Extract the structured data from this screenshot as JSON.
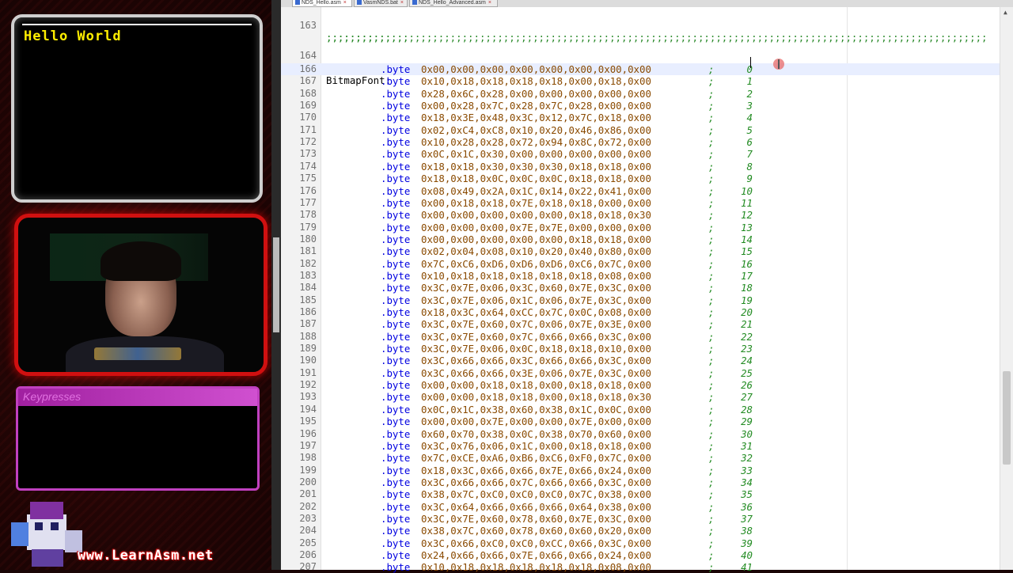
{
  "overlay": {
    "screen_text": "Hello World",
    "keypresses_title": "Keypresses",
    "site": "www.LearnAsm.net"
  },
  "tabs": [
    {
      "label": "NDS_Hello.asm",
      "active": true
    },
    {
      "label": "VasmNDS.bat",
      "active": false
    },
    {
      "label": "NDS_Hello_Advanced.asm",
      "active": false
    }
  ],
  "editor": {
    "separator": ";;;;;;;;;;;;;;;;;;;;;;;;;;;;;;;;;;;;;;;;;;;;;;;;;;;;;;;;;;;;;;;;;;;;;;;;;;;;;;;;;;;;;;;;;;;;;;;;;;;;;;;;;;;;;;;;",
    "separator_wrap": ";;;;;;;;;;;;;;",
    "label": "BitmapFont:",
    "keyword": ".byte",
    "comment_char": ";",
    "lines": [
      {
        "n": "166",
        "hex": "0x00,0x00,0x00,0x00,0x00,0x00,0x00,0x00",
        "c": "0"
      },
      {
        "n": "167",
        "hex": "0x10,0x18,0x18,0x18,0x18,0x00,0x18,0x00",
        "c": "1"
      },
      {
        "n": "168",
        "hex": "0x28,0x6C,0x28,0x00,0x00,0x00,0x00,0x00",
        "c": "2"
      },
      {
        "n": "169",
        "hex": "0x00,0x28,0x7C,0x28,0x7C,0x28,0x00,0x00",
        "c": "3"
      },
      {
        "n": "170",
        "hex": "0x18,0x3E,0x48,0x3C,0x12,0x7C,0x18,0x00",
        "c": "4"
      },
      {
        "n": "171",
        "hex": "0x02,0xC4,0xC8,0x10,0x20,0x46,0x86,0x00",
        "c": "5"
      },
      {
        "n": "172",
        "hex": "0x10,0x28,0x28,0x72,0x94,0x8C,0x72,0x00",
        "c": "6"
      },
      {
        "n": "173",
        "hex": "0x0C,0x1C,0x30,0x00,0x00,0x00,0x00,0x00",
        "c": "7"
      },
      {
        "n": "174",
        "hex": "0x18,0x18,0x30,0x30,0x30,0x18,0x18,0x00",
        "c": "8"
      },
      {
        "n": "175",
        "hex": "0x18,0x18,0x0C,0x0C,0x0C,0x18,0x18,0x00",
        "c": "9"
      },
      {
        "n": "176",
        "hex": "0x08,0x49,0x2A,0x1C,0x14,0x22,0x41,0x00",
        "c": "10"
      },
      {
        "n": "177",
        "hex": "0x00,0x18,0x18,0x7E,0x18,0x18,0x00,0x00",
        "c": "11"
      },
      {
        "n": "178",
        "hex": "0x00,0x00,0x00,0x00,0x00,0x18,0x18,0x30",
        "c": "12"
      },
      {
        "n": "179",
        "hex": "0x00,0x00,0x00,0x7E,0x7E,0x00,0x00,0x00",
        "c": "13"
      },
      {
        "n": "180",
        "hex": "0x00,0x00,0x00,0x00,0x00,0x18,0x18,0x00",
        "c": "14"
      },
      {
        "n": "181",
        "hex": "0x02,0x04,0x08,0x10,0x20,0x40,0x80,0x00",
        "c": "15"
      },
      {
        "n": "182",
        "hex": "0x7C,0xC6,0xD6,0xD6,0xD6,0xC6,0x7C,0x00",
        "c": "16"
      },
      {
        "n": "183",
        "hex": "0x10,0x18,0x18,0x18,0x18,0x18,0x08,0x00",
        "c": "17"
      },
      {
        "n": "184",
        "hex": "0x3C,0x7E,0x06,0x3C,0x60,0x7E,0x3C,0x00",
        "c": "18"
      },
      {
        "n": "185",
        "hex": "0x3C,0x7E,0x06,0x1C,0x06,0x7E,0x3C,0x00",
        "c": "19"
      },
      {
        "n": "186",
        "hex": "0x18,0x3C,0x64,0xCC,0x7C,0x0C,0x08,0x00",
        "c": "20"
      },
      {
        "n": "187",
        "hex": "0x3C,0x7E,0x60,0x7C,0x06,0x7E,0x3E,0x00",
        "c": "21"
      },
      {
        "n": "188",
        "hex": "0x3C,0x7E,0x60,0x7C,0x66,0x66,0x3C,0x00",
        "c": "22"
      },
      {
        "n": "189",
        "hex": "0x3C,0x7E,0x06,0x0C,0x18,0x18,0x10,0x00",
        "c": "23"
      },
      {
        "n": "190",
        "hex": "0x3C,0x66,0x66,0x3C,0x66,0x66,0x3C,0x00",
        "c": "24"
      },
      {
        "n": "191",
        "hex": "0x3C,0x66,0x66,0x3E,0x06,0x7E,0x3C,0x00",
        "c": "25"
      },
      {
        "n": "192",
        "hex": "0x00,0x00,0x18,0x18,0x00,0x18,0x18,0x00",
        "c": "26"
      },
      {
        "n": "193",
        "hex": "0x00,0x00,0x18,0x18,0x00,0x18,0x18,0x30",
        "c": "27"
      },
      {
        "n": "194",
        "hex": "0x0C,0x1C,0x38,0x60,0x38,0x1C,0x0C,0x00",
        "c": "28"
      },
      {
        "n": "195",
        "hex": "0x00,0x00,0x7E,0x00,0x00,0x7E,0x00,0x00",
        "c": "29"
      },
      {
        "n": "196",
        "hex": "0x60,0x70,0x38,0x0C,0x38,0x70,0x60,0x00",
        "c": "30"
      },
      {
        "n": "197",
        "hex": "0x3C,0x76,0x06,0x1C,0x00,0x18,0x18,0x00",
        "c": "31"
      },
      {
        "n": "198",
        "hex": "0x7C,0xCE,0xA6,0xB6,0xC6,0xF0,0x7C,0x00",
        "c": "32"
      },
      {
        "n": "199",
        "hex": "0x18,0x3C,0x66,0x66,0x7E,0x66,0x24,0x00",
        "c": "33"
      },
      {
        "n": "200",
        "hex": "0x3C,0x66,0x66,0x7C,0x66,0x66,0x3C,0x00",
        "c": "34"
      },
      {
        "n": "201",
        "hex": "0x38,0x7C,0xC0,0xC0,0xC0,0x7C,0x38,0x00",
        "c": "35"
      },
      {
        "n": "202",
        "hex": "0x3C,0x64,0x66,0x66,0x66,0x64,0x38,0x00",
        "c": "36"
      },
      {
        "n": "203",
        "hex": "0x3C,0x7E,0x60,0x78,0x60,0x7E,0x3C,0x00",
        "c": "37"
      },
      {
        "n": "204",
        "hex": "0x38,0x7C,0x60,0x78,0x60,0x60,0x20,0x00",
        "c": "38"
      },
      {
        "n": "205",
        "hex": "0x3C,0x66,0xC0,0xC0,0xCC,0x66,0x3C,0x00",
        "c": "39"
      },
      {
        "n": "206",
        "hex": "0x24,0x66,0x66,0x7E,0x66,0x66,0x24,0x00",
        "c": "40"
      },
      {
        "n": "207",
        "hex": "0x10,0x18,0x18,0x18,0x18,0x18,0x08,0x00",
        "c": "41"
      }
    ]
  }
}
